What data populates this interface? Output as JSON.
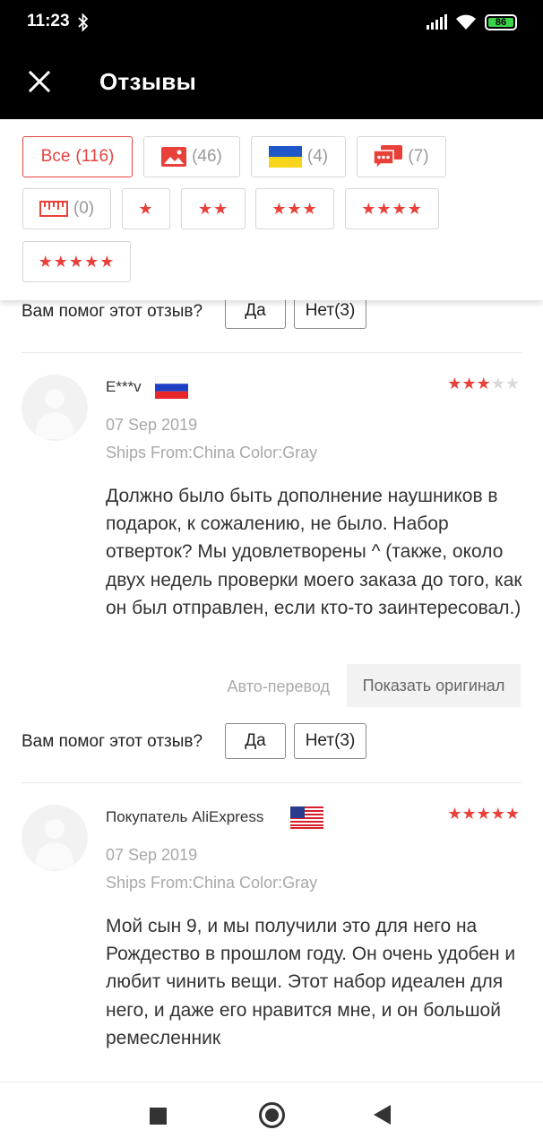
{
  "status_bar": {
    "time": "11:23",
    "battery": "86",
    "icons": [
      "bluetooth-icon",
      "signal-icon",
      "wifi-icon",
      "battery-icon"
    ]
  },
  "header": {
    "title": "Отзывы",
    "close_icon": "close-icon"
  },
  "filters": {
    "all": {
      "label": "Все",
      "count": "(116)"
    },
    "photos": {
      "icon": "photo-icon",
      "count": "(46)"
    },
    "ukraine": {
      "icon": "ukraine-flag-icon",
      "count": "(4)"
    },
    "comments": {
      "icon": "chat-icon",
      "count": "(7)"
    },
    "size": {
      "icon": "ruler-icon",
      "count": "(0)"
    },
    "star_1": "★",
    "star_2": "★★",
    "star_3": "★★★",
    "star_4": "★★★★",
    "star_5": "★★★★★"
  },
  "helpful": {
    "label": "Вам помог этот отзыв?",
    "yes": "Да",
    "no": "Нет(3)"
  },
  "reviews": [
    {
      "author": "E***v",
      "country_flag": "russia-flag-icon",
      "rating": 3,
      "rating_on": "★★★",
      "rating_off": "★★",
      "date": "07 Sep 2019",
      "ships": "Ships From:China Color:Gray",
      "text": "Должно было быть дополнение наушников в подарок, к сожалению, не было. Набор отверток? Мы удовлетворены ^ (также, около двух недель проверки моего заказа до того, как он был отправлен, если кто-то заинтересовал.)",
      "auto_translate": "Авто-перевод",
      "show_original": "Показать оригинал"
    },
    {
      "author": "Покупатель AliExpress",
      "country_flag": "usa-flag-icon",
      "rating": 5,
      "rating_on": "★★★★★",
      "rating_off": "",
      "date": "07 Sep 2019",
      "ships": "Ships From:China Color:Gray",
      "text": "Мой сын 9, и мы получили это для него на Рождество в прошлом году. Он очень удобен и любит чинить вещи. Этот набор идеален для него, и даже его нравится мне, и он большой ремесленник"
    }
  ],
  "colors": {
    "accent": "#e64340",
    "star": "#e8413a",
    "header_bg": "#000000"
  },
  "nav": {
    "icons": [
      "recents-square-icon",
      "home-circle-icon",
      "back-triangle-icon"
    ]
  }
}
